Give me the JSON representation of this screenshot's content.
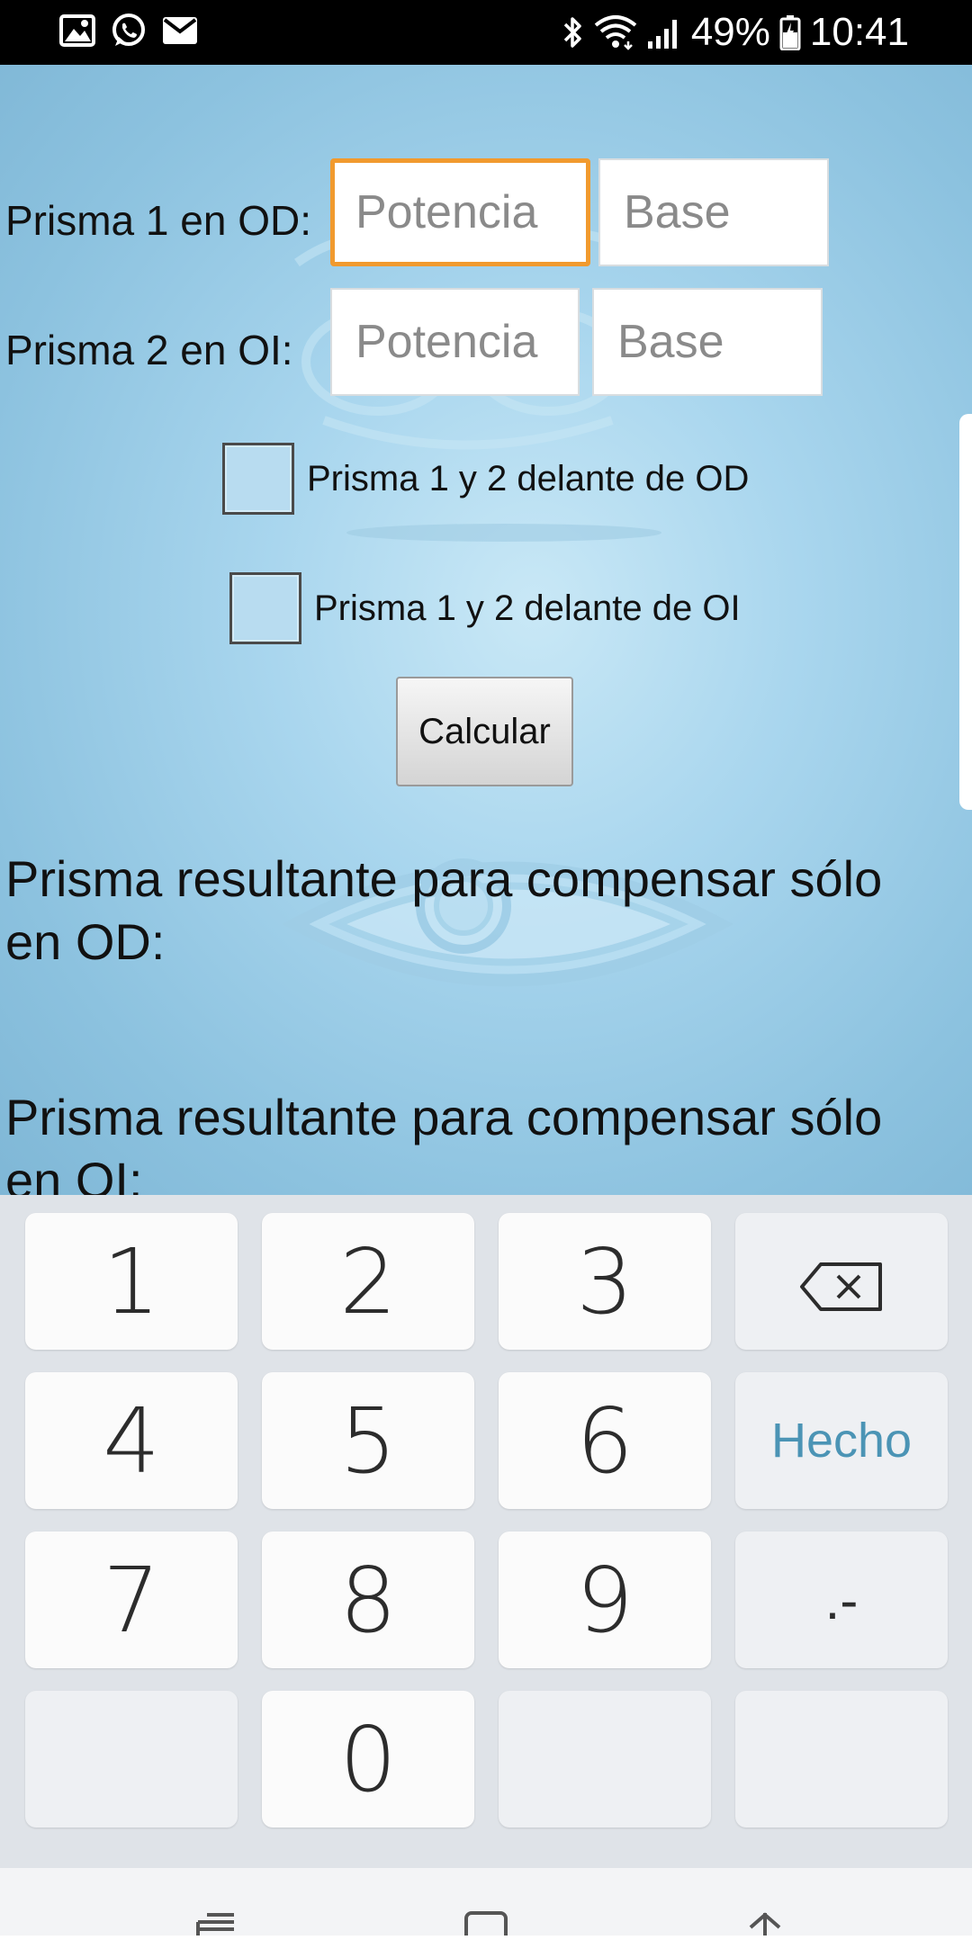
{
  "status_bar": {
    "battery": "49%",
    "time": "10:41",
    "left_icons": [
      "gallery-icon",
      "whatsapp-icon",
      "mail-icon"
    ],
    "right_icons": [
      "bluetooth-icon",
      "wifi-icon",
      "signal-icon",
      "battery-icon"
    ]
  },
  "form": {
    "prism1_label": "Prisma 1 en OD:",
    "prism2_label": "Prisma 2 en OI:",
    "power_placeholder": "Potencia",
    "base_placeholder": "Base",
    "checkbox_od_label": "Prisma 1 y 2 delante de OD",
    "checkbox_oi_label": "Prisma 1 y 2 delante de OI",
    "checkbox_od_checked": false,
    "checkbox_oi_checked": false,
    "calculate_label": "Calcular",
    "focused_field": "prism1-power"
  },
  "results": {
    "od_text": "Prisma resultante para compensar sólo en OD:",
    "oi_text": "Prisma resultante para compensar sólo en OI:"
  },
  "keyboard": {
    "keys": [
      "1",
      "2",
      "3",
      "4",
      "5",
      "6",
      "7",
      "8",
      "9",
      "0"
    ],
    "done_label": "Hecho",
    "dot_dash_label": ".-",
    "backspace_icon": "backspace-icon"
  },
  "colors": {
    "focus_border": "#f19a2e",
    "done_text": "#4b94b5",
    "background": "#a9d6ee",
    "keyboard_bg": "#dfe3e8"
  },
  "nav_bar": {
    "icons": [
      "recent-apps-icon",
      "home-icon",
      "back-icon"
    ]
  }
}
